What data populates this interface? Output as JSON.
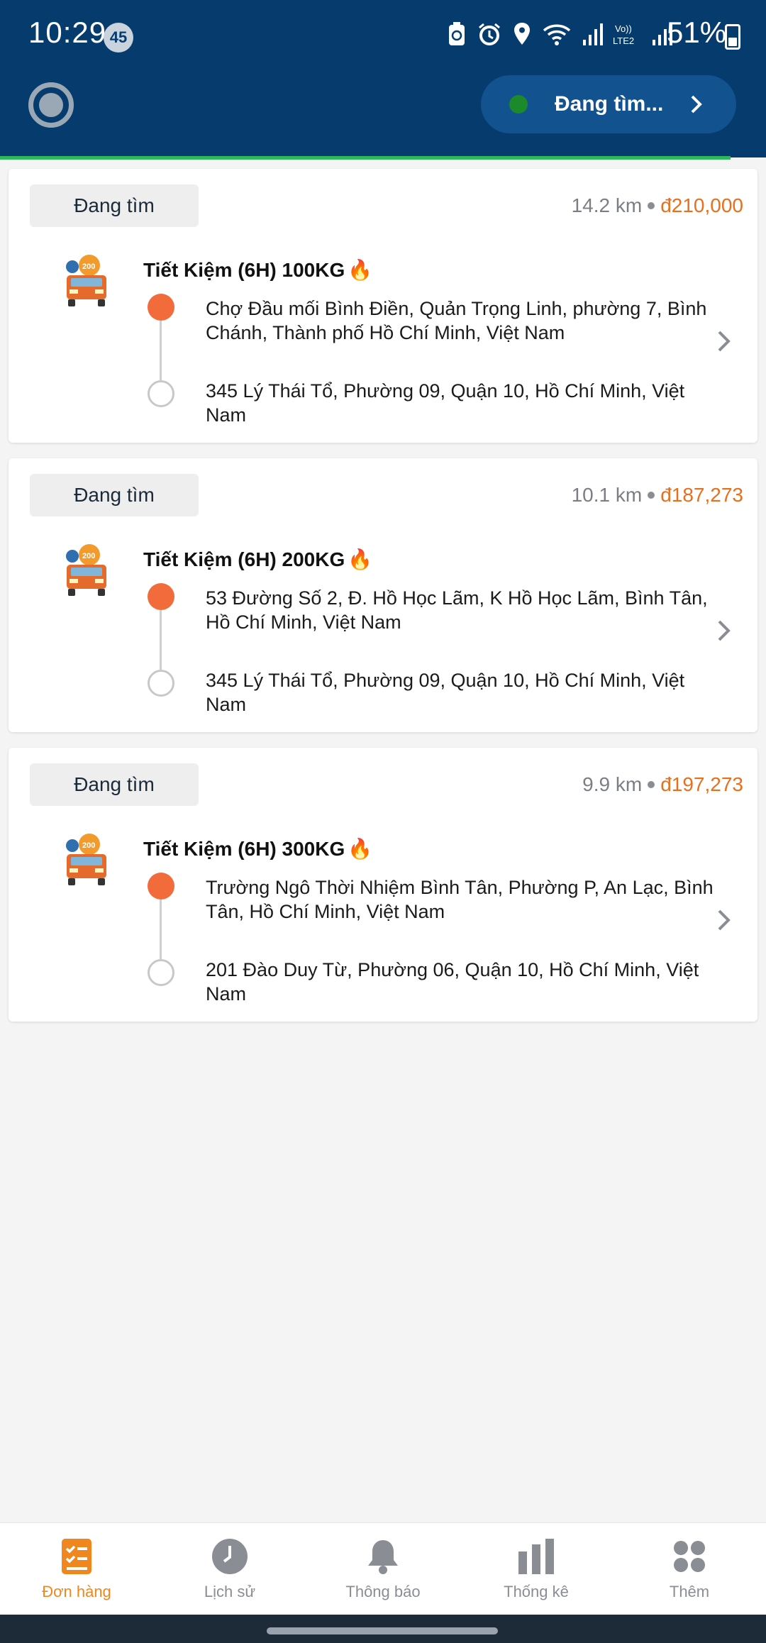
{
  "status_bar": {
    "time": "10:29",
    "badge": "45",
    "battery": "51%"
  },
  "header": {
    "search_status": "Đang tìm..."
  },
  "orders": [
    {
      "status": "Đang tìm",
      "distance": "14.2 km",
      "price": "đ210,000",
      "service": "Tiết Kiệm (6H) 100KG",
      "pickup": "Chợ Đầu mối Bình Điền, Quản Trọng Linh, phường 7, Bình Chánh, Thành phố Hồ Chí Minh, Việt Nam",
      "dropoff": "345 Lý Thái Tổ, Phường 09, Quận 10, Hồ Chí Minh, Việt Nam"
    },
    {
      "status": "Đang tìm",
      "distance": "10.1 km",
      "price": "đ187,273",
      "service": "Tiết Kiệm (6H) 200KG",
      "pickup": "53 Đường Số 2, Đ. Hồ Học Lãm, K Hồ Học Lãm, Bình Tân, Hồ Chí Minh, Việt Nam",
      "dropoff": "345 Lý Thái Tổ, Phường 09, Quận 10, Hồ Chí Minh, Việt Nam"
    },
    {
      "status": "Đang tìm",
      "distance": "9.9 km",
      "price": "đ197,273",
      "service": "Tiết Kiệm (6H) 300KG",
      "pickup": "Trường Ngô Thời Nhiệm Bình Tân, Phường P, An Lạc, Bình Tân, Hồ Chí Minh, Việt Nam",
      "dropoff": "201 Đào Duy Từ, Phường 06, Quận 10, Hồ Chí Minh, Việt Nam"
    }
  ],
  "bottom_nav": {
    "items": [
      {
        "label": "Đơn hàng",
        "icon": "orders-icon",
        "active": true
      },
      {
        "label": "Lịch sử",
        "icon": "history-icon",
        "active": false
      },
      {
        "label": "Thông báo",
        "icon": "bell-icon",
        "active": false
      },
      {
        "label": "Thống kê",
        "icon": "bar-chart-icon",
        "active": false
      },
      {
        "label": "Thêm",
        "icon": "more-icon",
        "active": false
      }
    ]
  },
  "colors": {
    "header_bg": "#063b6e",
    "accent_orange": "#e86f1e",
    "online_green": "#1c8a2a"
  }
}
